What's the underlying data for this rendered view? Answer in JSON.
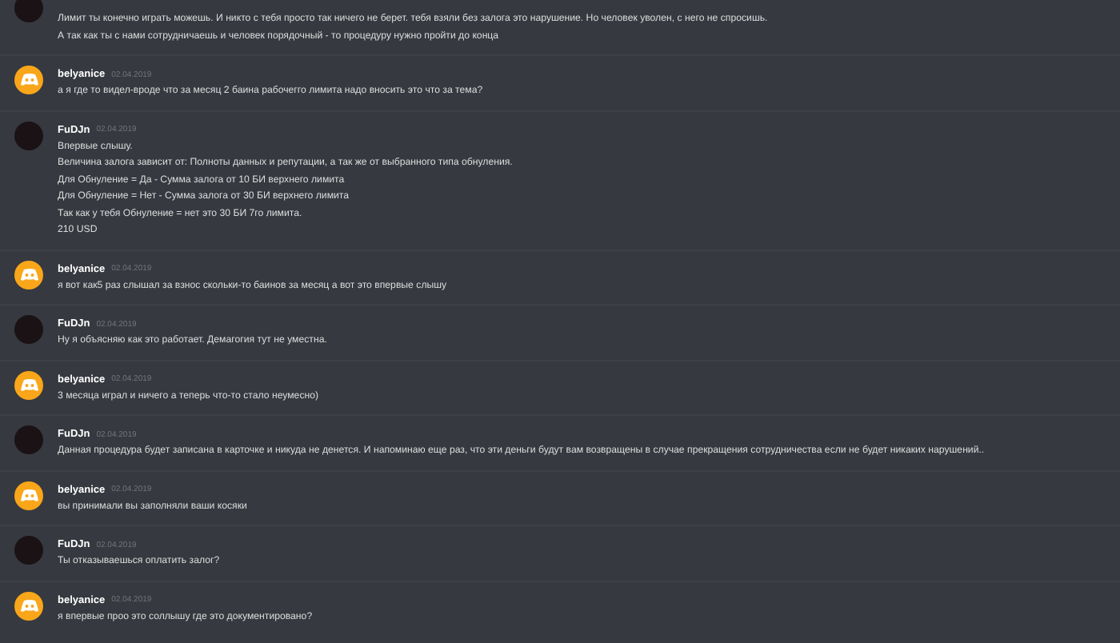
{
  "messages": [
    {
      "kind": "plain",
      "lines": [
        "Лимит ты конечно играть можешь. И никто с тебя просто так ничего не берет. тебя взяли без залога это нарушение. Но человек уволен, с него не спросишь.",
        "А так как ты с нами сотрудничаешь и человек порядочный - то процедуру нужно пройти до конца"
      ]
    },
    {
      "kind": "discord",
      "author": "belyanice",
      "time": "02.04.2019",
      "lines": [
        "а я где то видел-вроде что за месяц 2 баина рабочегго лимита надо вносить это что за тема?"
      ]
    },
    {
      "kind": "plain",
      "author": "FuDJn",
      "time": "02.04.2019",
      "lines": [
        "Впервые слышу.",
        "Величина залога зависит от: Полноты данных и репутации, а так же от выбранного типа обнуления.",
        "Для Обнуление = Да - Сумма залога от 10 БИ верхнего лимита",
        "Для Обнуление = Нет - Сумма залога от 30 БИ верхнего лимита",
        "Так как у тебя Обнуление = нет это 30 БИ 7го лимита.",
        "210 USD"
      ]
    },
    {
      "kind": "discord",
      "author": "belyanice",
      "time": "02.04.2019",
      "lines": [
        "я вот как5 раз слышал за взнос скольки-то баинов за месяц а вот это впервые слышу"
      ]
    },
    {
      "kind": "plain",
      "author": "FuDJn",
      "time": "02.04.2019",
      "lines": [
        "Ну я объясняю как это работает. Демагогия тут не уместна."
      ]
    },
    {
      "kind": "discord",
      "author": "belyanice",
      "time": "02.04.2019",
      "lines": [
        "3 месяца играл и ничего а теперь что-то стало неумесно)"
      ]
    },
    {
      "kind": "plain",
      "author": "FuDJn",
      "time": "02.04.2019",
      "lines": [
        "Данная процедура будет записана в карточке и никуда не денется. И напоминаю еще раз, что эти деньги будут вам возвращены в случае прекращения сотрудничества если не будет никаких нарушений.."
      ]
    },
    {
      "kind": "discord",
      "author": "belyanice",
      "time": "02.04.2019",
      "lines": [
        "вы принимали вы заполняли ваши косяки"
      ]
    },
    {
      "kind": "plain",
      "author": "FuDJn",
      "time": "02.04.2019",
      "lines": [
        "Ты отказываешься оплатить залог?"
      ]
    },
    {
      "kind": "discord",
      "author": "belyanice",
      "time": "02.04.2019",
      "lines": [
        "я впервые проо это соллышу где это документировано?"
      ]
    }
  ]
}
